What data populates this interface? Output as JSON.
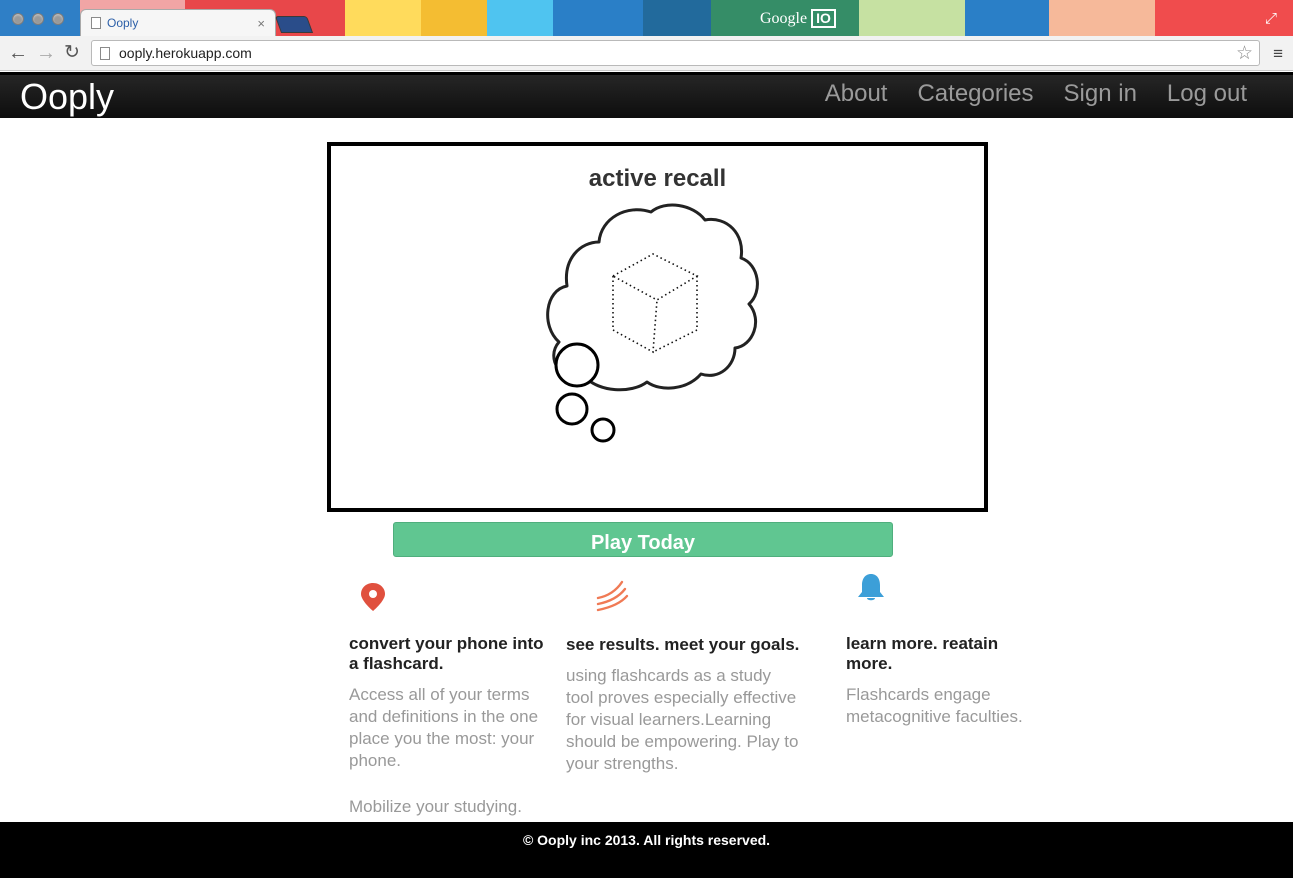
{
  "browser": {
    "tab_title": "Ooply",
    "tab_close": "×",
    "url": "ooply.herokuapp.com",
    "banner_text": "Google",
    "banner_badge": "IO",
    "stripe_colors": [
      "#2f7fc6",
      "#f1a5a5",
      "#e8474a",
      "#ffdb5c",
      "#f4bd32",
      "#4fc4f0",
      "#2a7fc7",
      "#226a9c",
      "#358d67",
      "#c6e1a2",
      "#2a7fc7",
      "#f6b99a",
      "#f04c4d"
    ]
  },
  "navbar": {
    "brand": "Ooply",
    "links": [
      "About",
      "Categories",
      "Sign in",
      "Log out"
    ]
  },
  "hero": {
    "title": "active recall"
  },
  "cta": {
    "label": "Play Today",
    "color": "#60c691"
  },
  "features": [
    {
      "icon": "map-pin-icon",
      "heading": "convert your phone into a flashcard.",
      "body": [
        "Access all of your terms and definitions in the one place you the most: your phone.",
        "Mobilize your studying."
      ]
    },
    {
      "icon": "rising-lines-icon",
      "heading": "see results. meet your goals.",
      "body": [
        "using flashcards as a study tool proves especially effective for visual learners.Learning should be empowering. Play to your strengths."
      ]
    },
    {
      "icon": "bell-icon",
      "heading": "learn more. reatain more.",
      "body": [
        "Flashcards engage metacognitive faculties."
      ]
    }
  ],
  "footer": {
    "text": "© Ooply inc 2013. All rights reserved."
  }
}
